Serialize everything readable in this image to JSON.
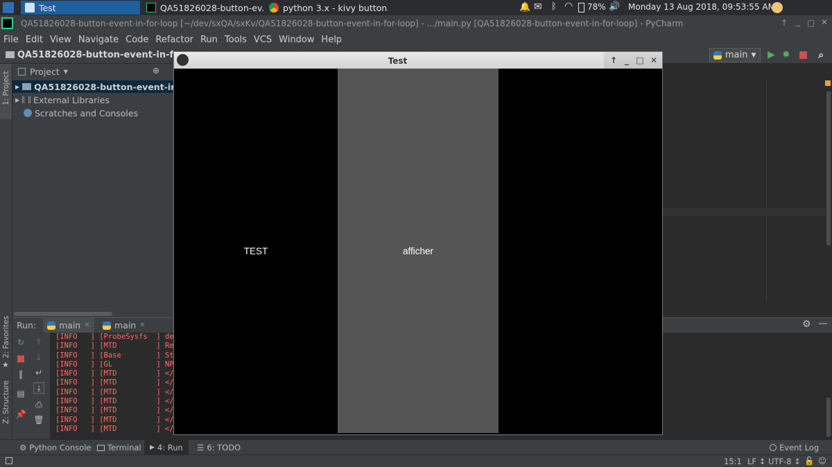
{
  "taskbar": {
    "tasks": [
      {
        "label": "Test"
      },
      {
        "label": "QA51826028-button-ev..."
      },
      {
        "label": "python 3.x - kivy button..."
      }
    ],
    "battery": "78%",
    "datetime": "Monday 13 Aug 2018, 09:53:55 AM"
  },
  "ide": {
    "title": "QA51826028-button-event-in-for-loop [~/dev/sxQA/sxKv/QA51826028-button-event-in-for-loop] - .../main.py [QA51826028-button-event-in-for-loop] - PyCharm",
    "menu": [
      "File",
      "Edit",
      "View",
      "Navigate",
      "Code",
      "Refactor",
      "Run",
      "Tools",
      "VCS",
      "Window",
      "Help"
    ],
    "breadcrumb": "QA51826028-button-event-in-for-lo",
    "run_config": "main",
    "project_pane": {
      "title": "Project",
      "items": [
        {
          "label": "QA51826028-button-event-in-fo"
        },
        {
          "label": "External Libraries"
        },
        {
          "label": "Scratches and Consoles"
        }
      ]
    },
    "left_tool_labels": {
      "project": "1: Project",
      "favorites": "2: Favorites",
      "structure": "Z: Structure"
    },
    "run": {
      "label": "Run:",
      "tabs": [
        {
          "label": "main"
        },
        {
          "label": "main"
        }
      ],
      "console_lines": [
        "[INFO   ] [ProbeSysfs  ] dev",
        "[INFO   ] [MTD         ] Rea",
        "[INFO   ] [Base        ] Sta",
        "[INFO   ] [GL          ] NPO",
        "[INFO   ] [MTD         ] </c",
        "[INFO   ] [MTD         ] </c",
        "[INFO   ] [MTD         ] </c",
        "[INFO   ] [MTD         ] </c",
        "[INFO   ] [MTD         ] </c",
        "[INFO   ] [MTD         ] </c",
        "[INFO   ] [MTD         ] </c"
      ]
    },
    "bottom_tabs": [
      "Python Console",
      "Terminal",
      "4: Run",
      "6: TODO"
    ],
    "event_log": "Event Log",
    "status": {
      "position": "15:1",
      "line_sep": "LF ↕",
      "encoding": "UTF-8 ↕"
    }
  },
  "kivy": {
    "title": "Test",
    "buttons": [
      {
        "label": "TEST",
        "bg": "#000000"
      },
      {
        "label": "afficher",
        "bg": "#555555"
      },
      {
        "label": "",
        "bg": "#000000"
      }
    ]
  },
  "colors": {
    "ide_bg": "#3c3f41",
    "editor_bg": "#2b2b2b",
    "console_text": "#ff6b68",
    "taskbar_active": "#1f5f9b"
  }
}
